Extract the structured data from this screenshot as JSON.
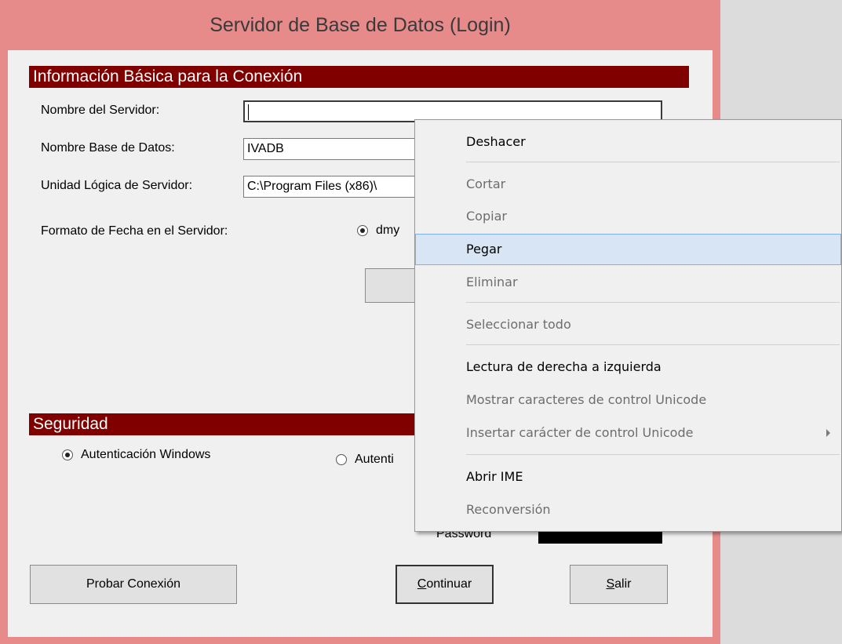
{
  "window": {
    "title": "Servidor de Base de Datos (Login)"
  },
  "connection": {
    "header": "Información Básica para la Conexión",
    "server_label": "Nombre del Servidor:",
    "server_value": "",
    "db_label": "Nombre Base de Datos:",
    "db_value": "IVADB",
    "unit_label": "Unidad Lógica de Servidor:",
    "unit_value": "C:\\Program Files (x86)\\",
    "date_label": "Formato de Fecha en el Servidor:",
    "date_option": "dmy"
  },
  "security": {
    "header": "Seguridad",
    "windows_auth": "Autenticación Windows",
    "other_auth": "Autenti",
    "password_label": "Password"
  },
  "buttons": {
    "test": "Probar Conexión",
    "continue_first": "C",
    "continue_rest": "ontinuar",
    "exit_first": "S",
    "exit_rest": "alir"
  },
  "context_menu": {
    "items": [
      {
        "label": "Deshacer",
        "enabled": true
      },
      {
        "label": "Cortar",
        "enabled": false
      },
      {
        "label": "Copiar",
        "enabled": false
      },
      {
        "label": "Pegar",
        "enabled": true
      },
      {
        "label": "Eliminar",
        "enabled": false
      },
      {
        "label": "Seleccionar todo",
        "enabled": false
      },
      {
        "label": "Lectura de derecha a izquierda",
        "enabled": true
      },
      {
        "label": "Mostrar caracteres de control Unicode",
        "enabled": false
      },
      {
        "label": "Insertar carácter de control Unicode",
        "enabled": false
      },
      {
        "label": "Abrir IME",
        "enabled": true
      },
      {
        "label": "Reconversión",
        "enabled": false
      }
    ]
  }
}
